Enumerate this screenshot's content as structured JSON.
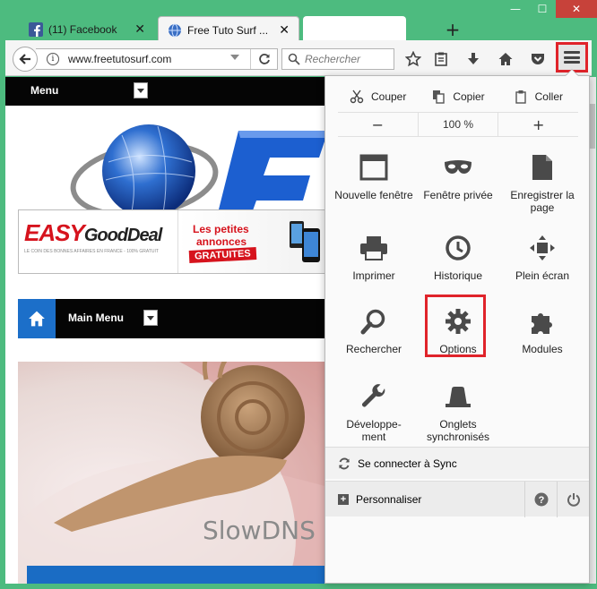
{
  "window": {
    "minimize": "—",
    "maximize": "☐",
    "close": "✕"
  },
  "tabs": [
    {
      "title": "(11) Facebook",
      "state": "inactive",
      "icon": "facebook-icon"
    },
    {
      "title": "Free Tuto Surf ...",
      "state": "active",
      "icon": "globe-icon"
    },
    {
      "title": "",
      "state": "blank",
      "icon": ""
    }
  ],
  "tab_new_label": "+",
  "navbar": {
    "url": "www.freetutosurf.com",
    "search_placeholder": "Rechercher"
  },
  "page": {
    "menu_label": "Menu",
    "ad_brand_red": "EASY",
    "ad_brand_black": "GoodDeal",
    "ad_tagline": "LE COIN DES BONNES AFFAIRES EN FRANCE - 100% GRATUIT",
    "ad_line1": "Les petites",
    "ad_line2": "annonces",
    "ad_line3": "GRATUITES",
    "main_menu_label": "Main Menu",
    "image_caption": "SlowDNS"
  },
  "panel": {
    "edit": {
      "cut": "Couper",
      "copy": "Copier",
      "paste": "Coller"
    },
    "zoom": {
      "minus": "−",
      "level": "100 %",
      "plus": "+"
    },
    "items": [
      {
        "label": "Nouvelle fenêtre",
        "icon": "window-icon"
      },
      {
        "label": "Fenêtre privée",
        "icon": "mask-icon"
      },
      {
        "label": "Enregistrer la page",
        "icon": "page-icon"
      },
      {
        "label": "Imprimer",
        "icon": "printer-icon"
      },
      {
        "label": "Historique",
        "icon": "clock-icon"
      },
      {
        "label": "Plein écran",
        "icon": "fullscreen-icon"
      },
      {
        "label": "Rechercher",
        "icon": "magnifier-icon"
      },
      {
        "label": "Options",
        "icon": "gear-icon"
      },
      {
        "label": "Modules",
        "icon": "puzzle-icon"
      },
      {
        "label": "Développe-ment",
        "icon": "wrench-icon"
      },
      {
        "label": "Onglets synchronisés",
        "icon": "synced-tabs-icon"
      }
    ],
    "sync_label": "Se connecter à Sync",
    "customize_label": "Personnaliser"
  },
  "colors": {
    "highlight": "#e0232a",
    "frame": "#4dbb7f",
    "accent_blue": "#1c6fc9"
  }
}
